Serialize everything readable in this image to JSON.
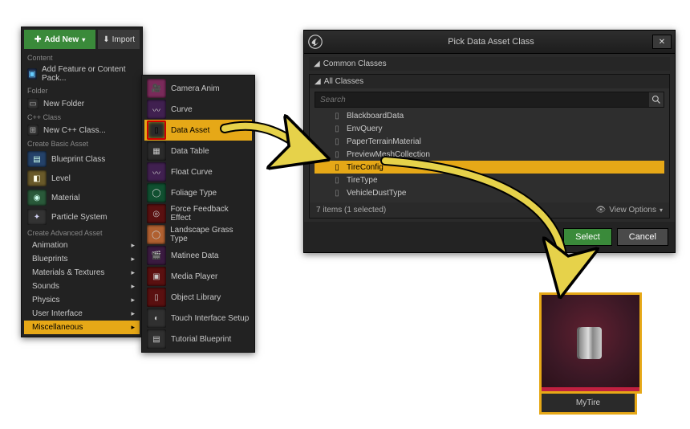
{
  "left_panel": {
    "add_new_label": "Add New",
    "import_label": "Import",
    "sections": {
      "content": "Content",
      "folder": "Folder",
      "cpp": "C++ Class",
      "basic": "Create Basic Asset",
      "advanced": "Create Advanced Asset"
    },
    "content_items": [
      {
        "label": "Add Feature or Content Pack..."
      }
    ],
    "folder_items": [
      {
        "label": "New Folder"
      }
    ],
    "cpp_items": [
      {
        "label": "New C++ Class..."
      }
    ],
    "basic_items": [
      {
        "label": "Blueprint Class"
      },
      {
        "label": "Level"
      },
      {
        "label": "Material"
      },
      {
        "label": "Particle System"
      }
    ],
    "advanced_items": [
      {
        "label": "Animation"
      },
      {
        "label": "Blueprints"
      },
      {
        "label": "Materials & Textures"
      },
      {
        "label": "Sounds"
      },
      {
        "label": "Physics"
      },
      {
        "label": "User Interface"
      },
      {
        "label": "Miscellaneous",
        "selected": true
      }
    ]
  },
  "submenu": {
    "items": [
      {
        "label": "Camera Anim"
      },
      {
        "label": "Curve"
      },
      {
        "label": "Data Asset",
        "selected": true
      },
      {
        "label": "Data Table"
      },
      {
        "label": "Float Curve"
      },
      {
        "label": "Foliage Type"
      },
      {
        "label": "Force Feedback Effect"
      },
      {
        "label": "Landscape Grass Type"
      },
      {
        "label": "Matinee Data"
      },
      {
        "label": "Media Player"
      },
      {
        "label": "Object Library"
      },
      {
        "label": "Touch Interface Setup"
      },
      {
        "label": "Tutorial Blueprint"
      }
    ]
  },
  "dialog": {
    "title": "Pick Data Asset Class",
    "common_header": "Common Classes",
    "all_header": "All Classes",
    "search_placeholder": "Search",
    "classes": [
      {
        "label": "BlackboardData"
      },
      {
        "label": "EnvQuery"
      },
      {
        "label": "PaperTerrainMaterial"
      },
      {
        "label": "PreviewMeshCollection"
      },
      {
        "label": "TireConfig",
        "selected": true
      },
      {
        "label": "TireType"
      },
      {
        "label": "VehicleDustType"
      }
    ],
    "status": "7 items (1 selected)",
    "view_options": "View Options",
    "select_label": "Select",
    "cancel_label": "Cancel"
  },
  "asset": {
    "name": "MyTire"
  },
  "thumb_colors": {
    "camera": "#7a2a5a",
    "curve": "#402050",
    "data_asset": "#2a2a2a",
    "data_table": "#2a2a2a",
    "float_curve": "#402050",
    "foliage": "#105030",
    "force": "#5a1010",
    "grass": "#b06030",
    "matinee": "#3a1a40",
    "media": "#5a1010",
    "object": "#5a1010",
    "touch": "#303030",
    "tutorial": "#303030"
  }
}
